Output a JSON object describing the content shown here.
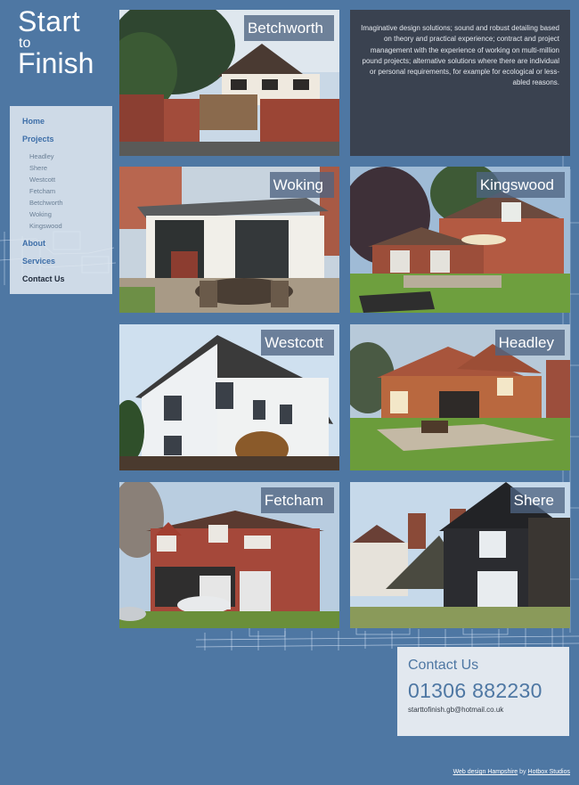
{
  "logo": {
    "line1": "Start",
    "line2": "to",
    "line3": "Finish"
  },
  "nav": {
    "home": "Home",
    "projects": "Projects",
    "sub": [
      "Headley",
      "Shere",
      "Westcott",
      "Fetcham",
      "Betchworth",
      "Woking",
      "Kingswood"
    ],
    "about": "About",
    "services": "Services",
    "contact": "Contact Us"
  },
  "intro": "Imaginative design solutions; sound and robust detailing based on theory and practical experience; contract and project management with the experience of working on multi-million pound projects; alternative solutions where there are individual or personal requirements, for example for ecological or less-abled reasons.",
  "tiles": {
    "betchworth": "Betchworth",
    "woking": "Woking",
    "kingswood": "Kingswood",
    "westcott": "Westcott",
    "headley": "Headley",
    "fetcham": "Fetcham",
    "shere": "Shere"
  },
  "contact": {
    "title": "Contact Us",
    "phone": "01306 882230",
    "email": "starttofinish.gb@hotmail.co.uk"
  },
  "footer": {
    "link1": "Web design Hampshire",
    "by": "by",
    "link2": "Hotbox Studios"
  },
  "colors": {
    "background": "#4e77a3",
    "nav_link": "#3d6ea8",
    "intro_bg": "#3a4250",
    "contact_bg": "#e2e8ef"
  }
}
